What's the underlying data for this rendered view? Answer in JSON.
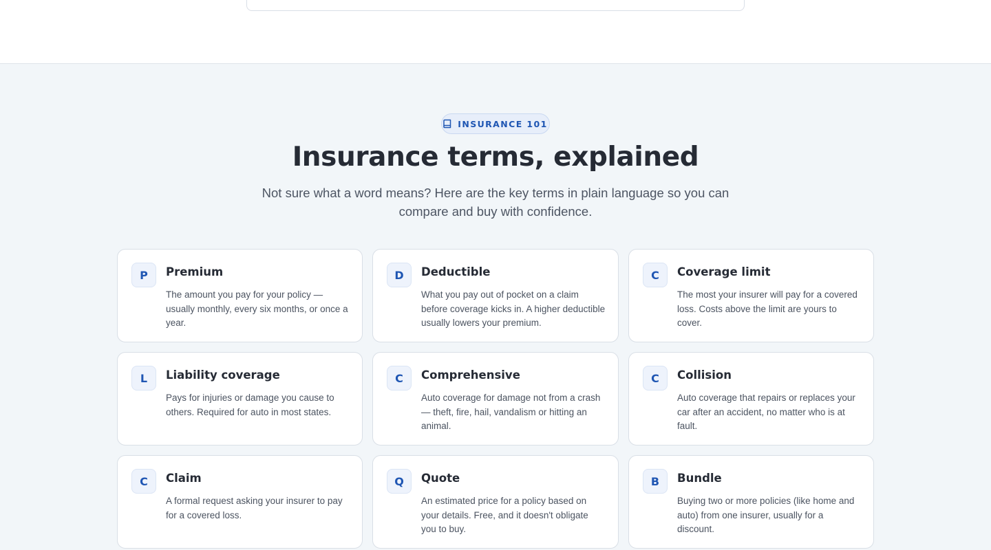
{
  "section": {
    "badge": {
      "icon": "book-icon",
      "label": "INSURANCE 101"
    },
    "title": "Insurance terms, explained",
    "subtitle": "Not sure what a word means? Here are the key terms in plain language so you can compare and buy with confidence."
  },
  "terms": [
    {
      "letter": "P",
      "title": "Premium",
      "description": "The amount you pay for your policy — usually monthly, every six months, or once a year."
    },
    {
      "letter": "D",
      "title": "Deductible",
      "description": "What you pay out of pocket on a claim before coverage kicks in. A higher deductible usually lowers your premium."
    },
    {
      "letter": "C",
      "title": "Coverage limit",
      "description": "The most your insurer will pay for a covered loss. Costs above the limit are yours to cover."
    },
    {
      "letter": "L",
      "title": "Liability coverage",
      "description": "Pays for injuries or damage you cause to others. Required for auto in most states."
    },
    {
      "letter": "C",
      "title": "Comprehensive",
      "description": "Auto coverage for damage not from a crash — theft, fire, hail, vandalism or hitting an animal."
    },
    {
      "letter": "C",
      "title": "Collision",
      "description": "Auto coverage that repairs or replaces your car after an accident, no matter who is at fault."
    },
    {
      "letter": "C",
      "title": "Claim",
      "description": "A formal request asking your insurer to pay for a covered loss."
    },
    {
      "letter": "Q",
      "title": "Quote",
      "description": "An estimated price for a policy based on your details. Free, and it doesn't obligate you to buy."
    },
    {
      "letter": "B",
      "title": "Bundle",
      "description": "Buying two or more policies (like home and auto) from one insurer, usually for a discount."
    }
  ],
  "colors": {
    "accent": "#1f56b3",
    "heading": "#262b35",
    "section_bg": "#f2f6f9"
  }
}
